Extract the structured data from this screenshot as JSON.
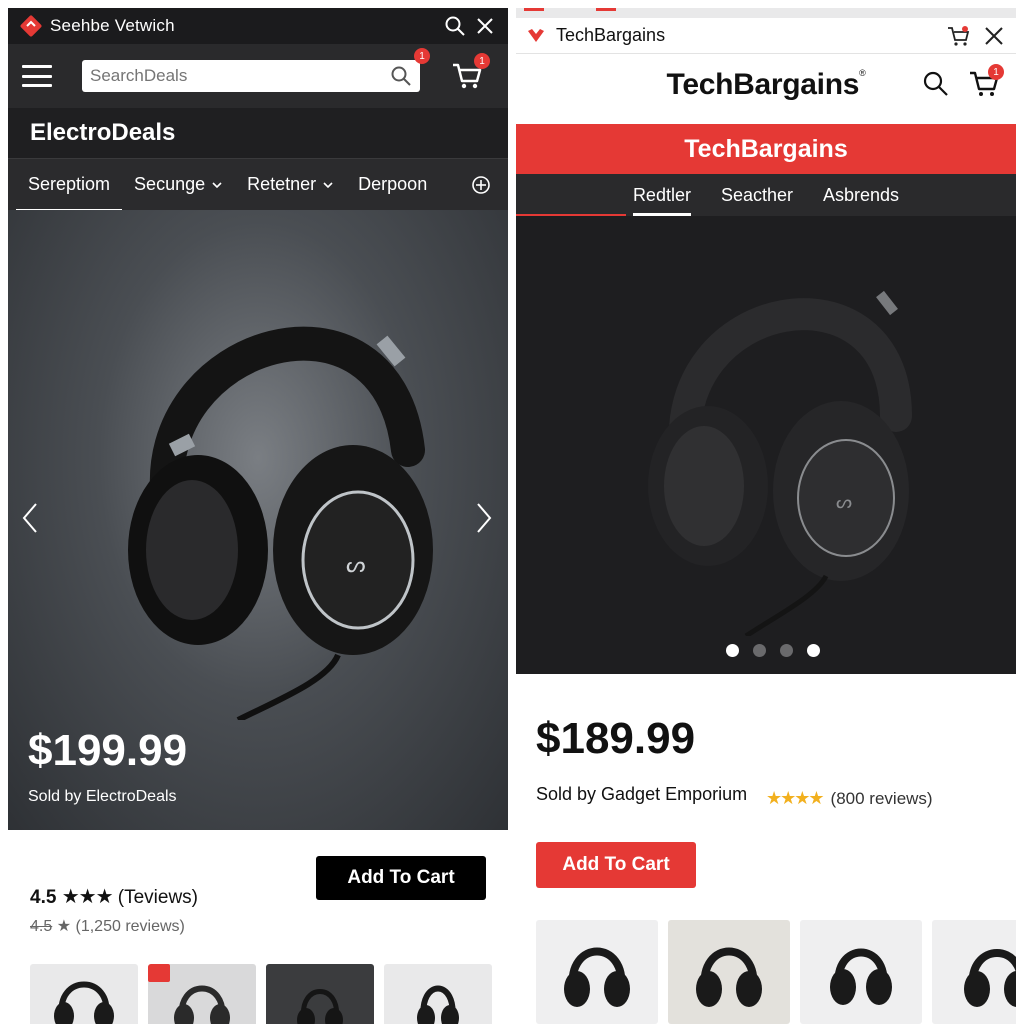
{
  "left": {
    "window_title": "Seehbe Vetwich",
    "search": {
      "placeholder": "SearchDeals",
      "badge": "1"
    },
    "cart_badge": "1",
    "brand": "ElectroDeals",
    "tabs": [
      {
        "label": "Sereptiom",
        "dropdown": false,
        "active": true
      },
      {
        "label": "Secunge",
        "dropdown": true,
        "active": false
      },
      {
        "label": "Retetner",
        "dropdown": true,
        "active": false
      },
      {
        "label": "Derpoon",
        "dropdown": false,
        "active": false
      }
    ],
    "price": "$199.99",
    "seller": "Sold by ElectroDeals",
    "add_to_cart": "Add To Cart",
    "rating_primary": {
      "value": "4.5",
      "stars": "★★★",
      "reviews": "(Teviews)"
    },
    "rating_secondary": {
      "value": "4.5",
      "stars": "★",
      "reviews": "(1,250 reviews)"
    },
    "thumbnails": 4
  },
  "right": {
    "window_title": "TechBargains",
    "brand": "TechBargains",
    "brand_mark": "®",
    "banner": "TechBargains",
    "cart_badge": "1",
    "tabs": [
      {
        "label": "Redtler",
        "active": true
      },
      {
        "label": "Seacther",
        "active": false
      },
      {
        "label": "Asbrends",
        "active": false
      }
    ],
    "carousel": {
      "total": 4,
      "active_indices": [
        0,
        3
      ]
    },
    "price": "$189.99",
    "seller": "Sold by Gadget Emporium",
    "stars": "★★★★",
    "reviews": "(800 reviews)",
    "add_to_cart": "Add To Cart",
    "thumbnails": 4
  },
  "colors": {
    "accent_red": "#e53935",
    "dark_header": "#2a2a2c",
    "star_gold": "#f2b01e"
  }
}
